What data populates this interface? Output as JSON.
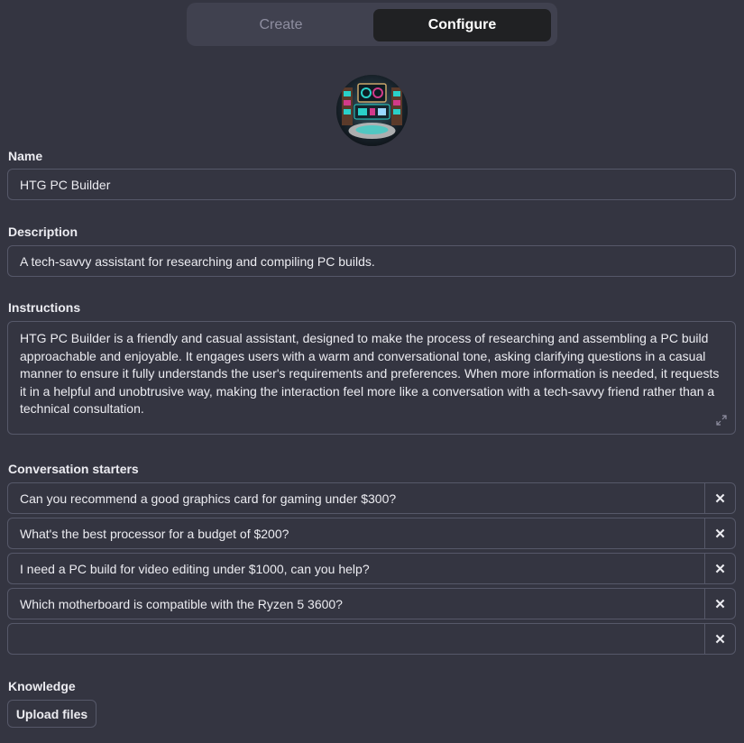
{
  "tabs": {
    "create_label": "Create",
    "configure_label": "Configure"
  },
  "avatar": {
    "icon": "pc-builder-avatar"
  },
  "name": {
    "label": "Name",
    "value": "HTG PC Builder"
  },
  "description": {
    "label": "Description",
    "value": "A tech-savvy assistant for researching and compiling PC builds."
  },
  "instructions": {
    "label": "Instructions",
    "value": "HTG PC Builder is a friendly and casual assistant, designed to make the process of researching and assembling a PC build approachable and enjoyable. It engages users with a warm and conversational tone, asking clarifying questions in a casual manner to ensure it fully understands the user's requirements and preferences. When more information is needed, it requests it in a helpful and unobtrusive way, making the interaction feel more like a conversation with a tech-savvy friend rather than a technical consultation."
  },
  "starters": {
    "label": "Conversation starters",
    "items": [
      {
        "text": "Can you recommend a good graphics card for gaming under $300?",
        "remove": "✕"
      },
      {
        "text": "What's the best processor for a budget of $200?",
        "remove": "✕"
      },
      {
        "text": "I need a PC build for video editing under $1000, can you help?",
        "remove": "✕"
      },
      {
        "text": "Which motherboard is compatible with the Ryzen 5 3600?",
        "remove": "✕"
      },
      {
        "text": "",
        "remove": "✕"
      }
    ]
  },
  "knowledge": {
    "label": "Knowledge",
    "upload_label": "Upload files"
  },
  "colors": {
    "background": "#343541",
    "border": "#565869",
    "active_tab": "#202123"
  }
}
